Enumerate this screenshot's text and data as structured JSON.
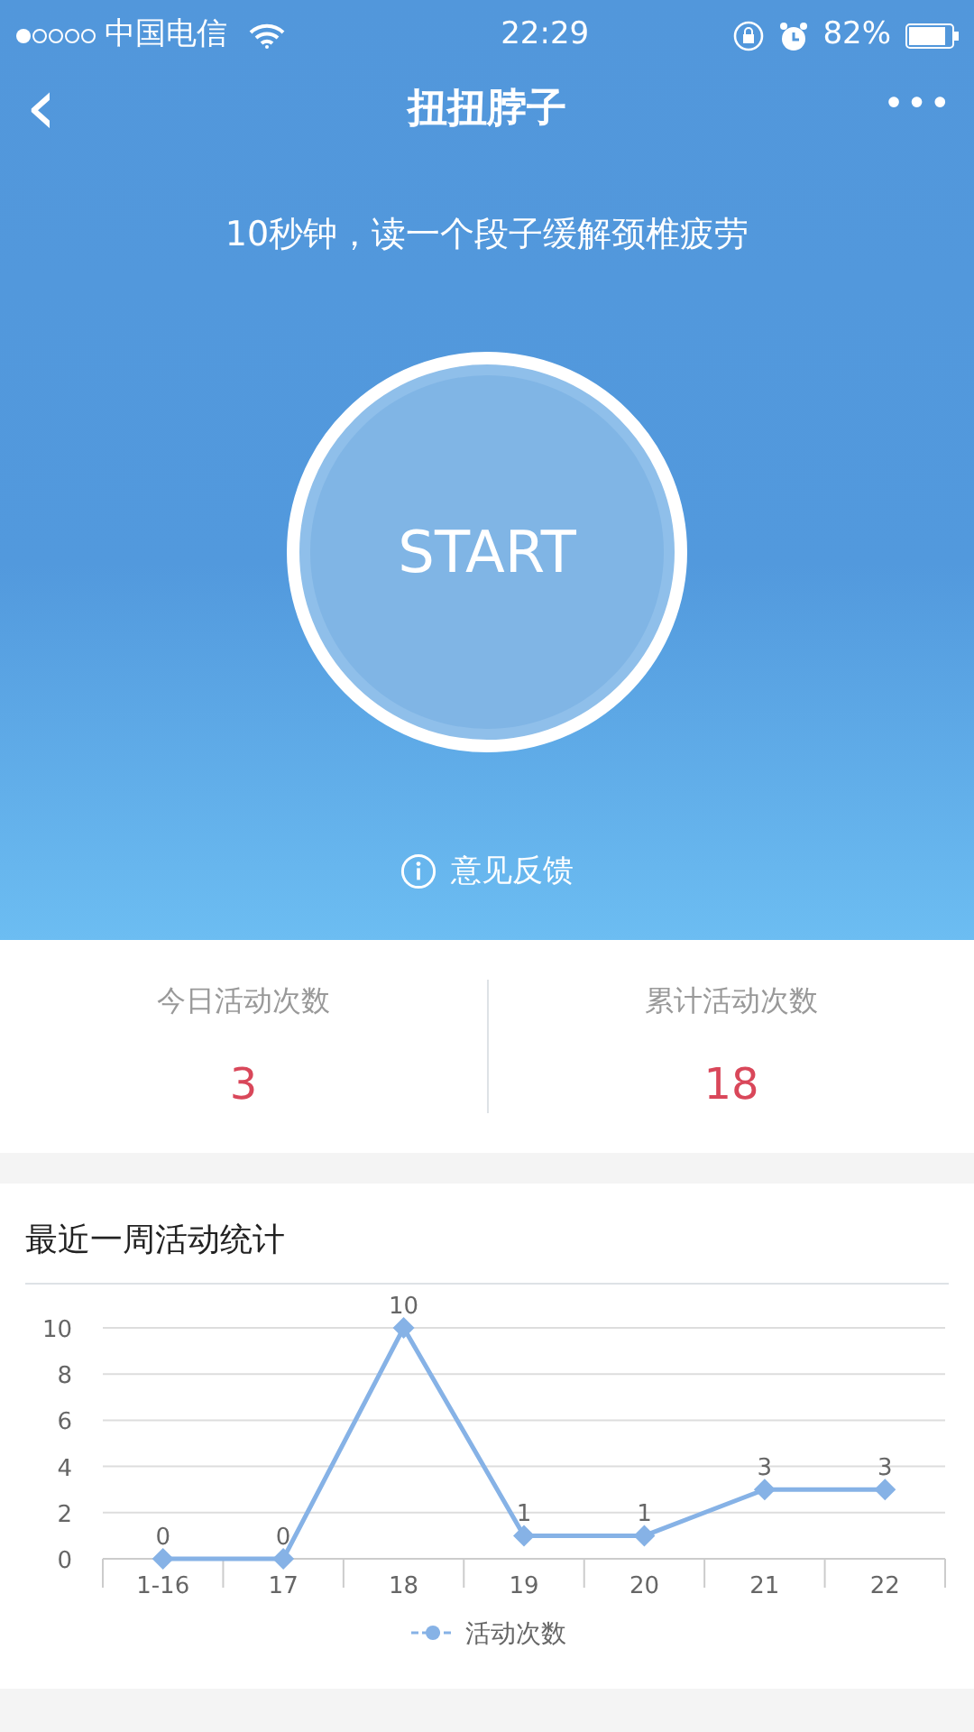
{
  "status_bar": {
    "carrier": "中国电信",
    "time": "22:29",
    "battery": "82%"
  },
  "nav": {
    "back": "‹",
    "title": "扭扭脖子",
    "more": "•••"
  },
  "header": {
    "subtitle": "10秒钟，读一个段子缓解颈椎疲劳",
    "start": "START",
    "feedback": "意见反馈"
  },
  "stats": [
    {
      "label": "今日活动次数",
      "value": "3"
    },
    {
      "label": "累计活动次数",
      "value": "18"
    }
  ],
  "chart_card": {
    "title": "最近一周活动统计",
    "chart_data": {
      "type": "line",
      "categories": [
        "1-16",
        "17",
        "18",
        "19",
        "20",
        "21",
        "22"
      ],
      "series": [
        {
          "name": "活动次数",
          "color": "#86b2e6",
          "marker": "diamond",
          "values": [
            0,
            0,
            10,
            1,
            1,
            3,
            3
          ]
        }
      ],
      "ylim": [
        0,
        10
      ],
      "yticks": [
        0,
        2,
        4,
        6,
        8,
        10
      ],
      "grid": true,
      "data_labels": true
    }
  }
}
